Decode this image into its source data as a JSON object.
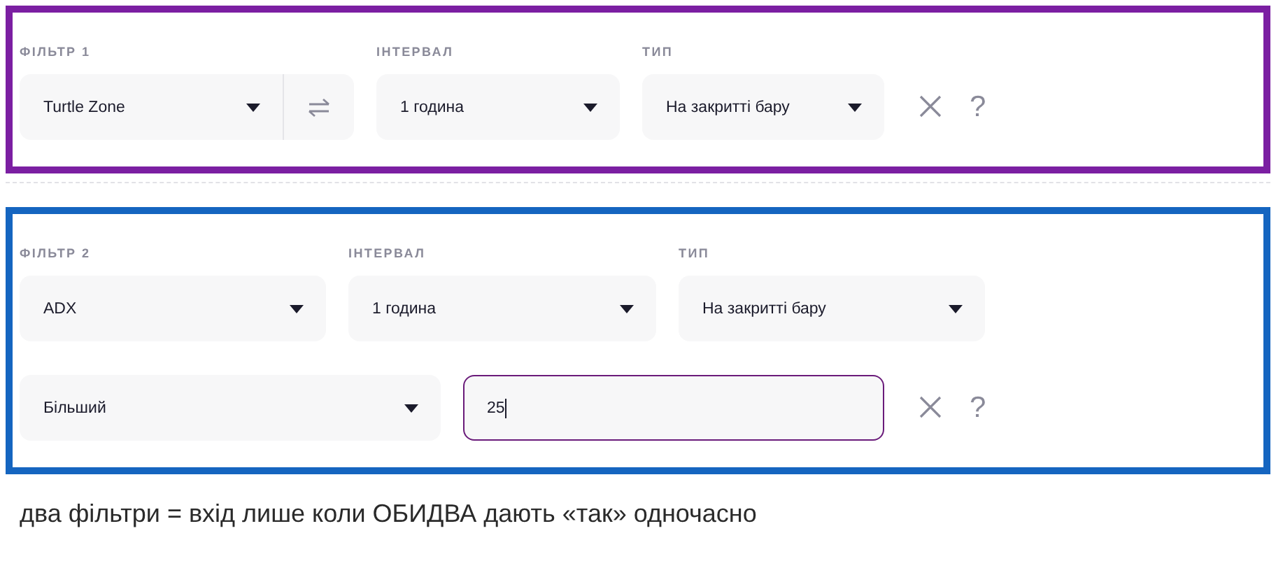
{
  "filters": [
    {
      "color": "#7b1fa2",
      "rows": [
        [
          {
            "kind": "select_swap",
            "label": "ФІЛЬТР 1",
            "value": "Turtle Zone"
          },
          {
            "kind": "select",
            "label": "ІНТЕРВАЛ",
            "value": "1 година"
          },
          {
            "kind": "select",
            "label": "ТИП",
            "value": "На закритті бару"
          }
        ]
      ],
      "help": "?"
    },
    {
      "color": "#1565c0",
      "rows": [
        [
          {
            "kind": "select",
            "label": "ФІЛЬТР 2",
            "value": "ADX"
          },
          {
            "kind": "select",
            "label": "ІНТЕРВАЛ",
            "value": "1 година"
          },
          {
            "kind": "select",
            "label": "ТИП",
            "value": "На закритті бару"
          }
        ],
        [
          {
            "kind": "select",
            "value": "Більший"
          },
          {
            "kind": "input",
            "value": "25",
            "focused": true
          }
        ]
      ],
      "help": "?"
    }
  ],
  "caption": "два фільтри = вхід лише коли ОБИДВА дають «так» одночасно"
}
